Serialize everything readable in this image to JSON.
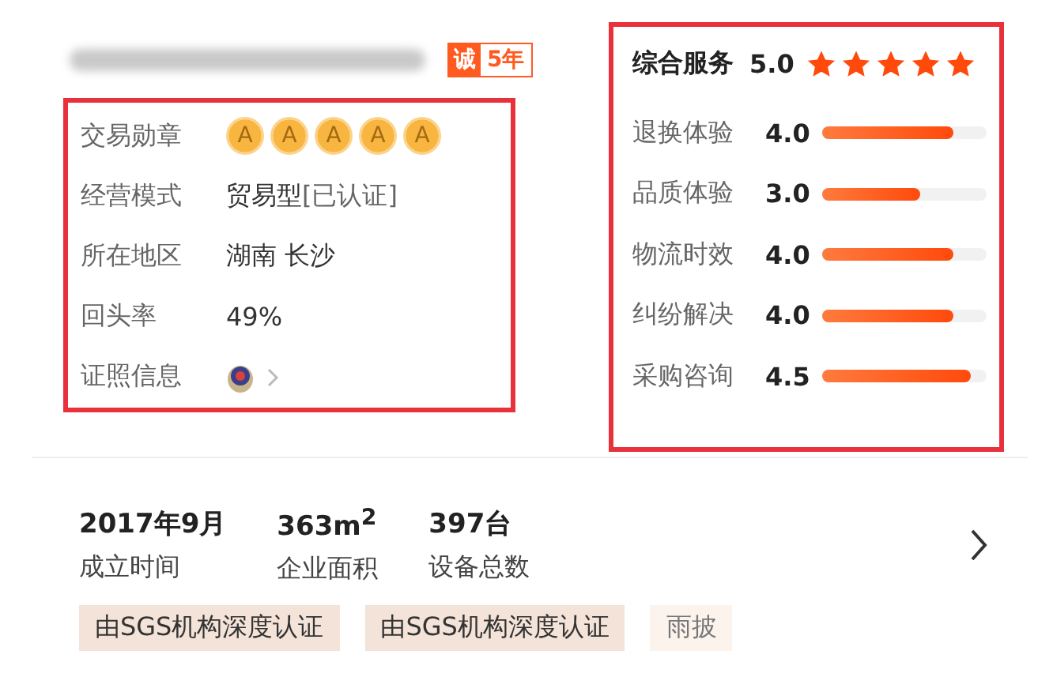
{
  "header": {
    "badge_mark": "诚",
    "badge_years": "5年"
  },
  "info": [
    {
      "kind": "medals",
      "label": "交易勋章",
      "medals": [
        "A",
        "A",
        "A",
        "A",
        "A"
      ]
    },
    {
      "kind": "text",
      "label": "经营模式",
      "value": "贸易型",
      "note": "[已认证]"
    },
    {
      "kind": "text",
      "label": "所在地区",
      "value": "湖南 长沙"
    },
    {
      "kind": "text",
      "label": "回头率",
      "value": "49%"
    },
    {
      "kind": "license",
      "label": "证照信息"
    }
  ],
  "service": {
    "label": "综合服务",
    "score": "5.0",
    "stars": 5,
    "items": [
      {
        "label": "退换体验",
        "score": "4.0",
        "level": 0.8
      },
      {
        "label": "品质体验",
        "score": "3.0",
        "level": 0.6
      },
      {
        "label": "物流时效",
        "score": "4.0",
        "level": 0.8
      },
      {
        "label": "纠纷解决",
        "score": "4.0",
        "level": 0.8
      },
      {
        "label": "采购咨询",
        "score": "4.5",
        "level": 0.9
      }
    ]
  },
  "stats": [
    {
      "value": "2017年9月",
      "label": "成立时间"
    },
    {
      "value": "363m$^{2}$",
      "label": "企业面积"
    },
    {
      "value": "397台",
      "label": "设备总数"
    }
  ],
  "tags": [
    {
      "text": "由SGS机构深度认证",
      "kind": "certified"
    },
    {
      "text": "由SGS机构深度认证",
      "kind": "certified"
    },
    {
      "text": "雨披",
      "kind": "plain"
    }
  ]
}
